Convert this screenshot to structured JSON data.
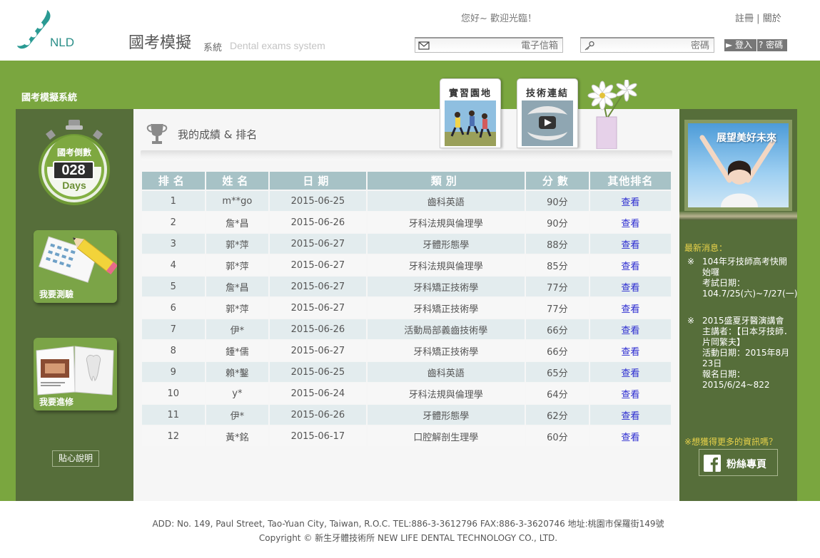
{
  "header": {
    "logo_text": "NLD",
    "site_title": "國考模擬",
    "site_sub": "系統",
    "site_sub_en": "Dental exams system",
    "welcome": "您好~ 歡迎光臨！",
    "register_label": "註冊",
    "link_sep": "|",
    "about_label": "關於",
    "email_placeholder": "電子信箱",
    "password_placeholder": "密碼",
    "login_label": "► 登入",
    "forgot_label": "? 密碼"
  },
  "band": {
    "system_label": "國考模擬系統"
  },
  "countdown": {
    "label": "國考倒數",
    "number": "028",
    "unit": "Days"
  },
  "sidebar": {
    "test_label": "我要測驗",
    "study_label": "我要進修",
    "help_label": "貼心說明"
  },
  "tabs": [
    {
      "label": "實習園地"
    },
    {
      "label": "技術連結"
    }
  ],
  "main": {
    "section_title": "我的成績 & 排名"
  },
  "table": {
    "headers": [
      "排名",
      "姓名",
      "日期",
      "類別",
      "分數",
      "其他排名"
    ],
    "rows": [
      {
        "rank": "1",
        "name": "m**go",
        "date": "2015-06-25",
        "category": "齒科英語",
        "score": "90分",
        "view": "查看"
      },
      {
        "rank": "2",
        "name": "詹*昌",
        "date": "2015-06-26",
        "category": "牙科法規與倫理學",
        "score": "90分",
        "view": "查看"
      },
      {
        "rank": "3",
        "name": "郭*萍",
        "date": "2015-06-27",
        "category": "牙體形態學",
        "score": "88分",
        "view": "查看"
      },
      {
        "rank": "4",
        "name": "郭*萍",
        "date": "2015-06-27",
        "category": "牙科法規與倫理學",
        "score": "85分",
        "view": "查看"
      },
      {
        "rank": "5",
        "name": "詹*昌",
        "date": "2015-06-27",
        "category": "牙科矯正技術學",
        "score": "77分",
        "view": "查看"
      },
      {
        "rank": "6",
        "name": "郭*萍",
        "date": "2015-06-27",
        "category": "牙科矯正技術學",
        "score": "77分",
        "view": "查看"
      },
      {
        "rank": "7",
        "name": "伊*",
        "date": "2015-06-26",
        "category": "活動局部義齒技術學",
        "score": "66分",
        "view": "查看"
      },
      {
        "rank": "8",
        "name": "鍾*儒",
        "date": "2015-06-27",
        "category": "牙科矯正技術學",
        "score": "66分",
        "view": "查看"
      },
      {
        "rank": "9",
        "name": "賴*鑿",
        "date": "2015-06-25",
        "category": "齒科英語",
        "score": "65分",
        "view": "查看"
      },
      {
        "rank": "10",
        "name": "y*",
        "date": "2015-06-24",
        "category": "牙科法規與倫理學",
        "score": "64分",
        "view": "查看"
      },
      {
        "rank": "11",
        "name": "伊*",
        "date": "2015-06-26",
        "category": "牙體形態學",
        "score": "62分",
        "view": "查看"
      },
      {
        "rank": "12",
        "name": "黃*銘",
        "date": "2015-06-17",
        "category": "口腔解剖生理學",
        "score": "60分",
        "view": "查看"
      }
    ]
  },
  "right": {
    "banner_text": "展望美好未來",
    "news_head": "最新消息：",
    "news": [
      {
        "mark": "※",
        "lines": [
          "104年牙技師高考快開始囉",
          "考試日期：",
          "104.7/25(六)~7/27(一)"
        ]
      },
      {
        "mark": "※",
        "lines": [
          "2015盛夏牙醫演講會",
          "主講者：【日本牙技師．片岡繁夫】",
          "活動日期：2015年8月23日",
          "報名日期：",
          "2015/6/24~822"
        ]
      }
    ],
    "more_info": "※想獲得更多的資訊嗎？",
    "fb_label": "粉絲專頁"
  },
  "footer": {
    "address": "ADD: No. 149, Paul Street, Tao-Yuan City, Taiwan, R.O.C. TEL:886-3-3612796 FAX:886-3-3620746 地址:桃園市保羅街149號",
    "copyright": "Copyright © 新生牙體技術所 NEW LIFE DENTAL TECHNOLOGY CO., LTD."
  },
  "colors": {
    "band_green": "#7aa63f",
    "dark_green": "#566e3a",
    "table_header": "#a7c2c6",
    "link_blue": "#2a2ad0",
    "news_yellow": "#e8d24a"
  }
}
